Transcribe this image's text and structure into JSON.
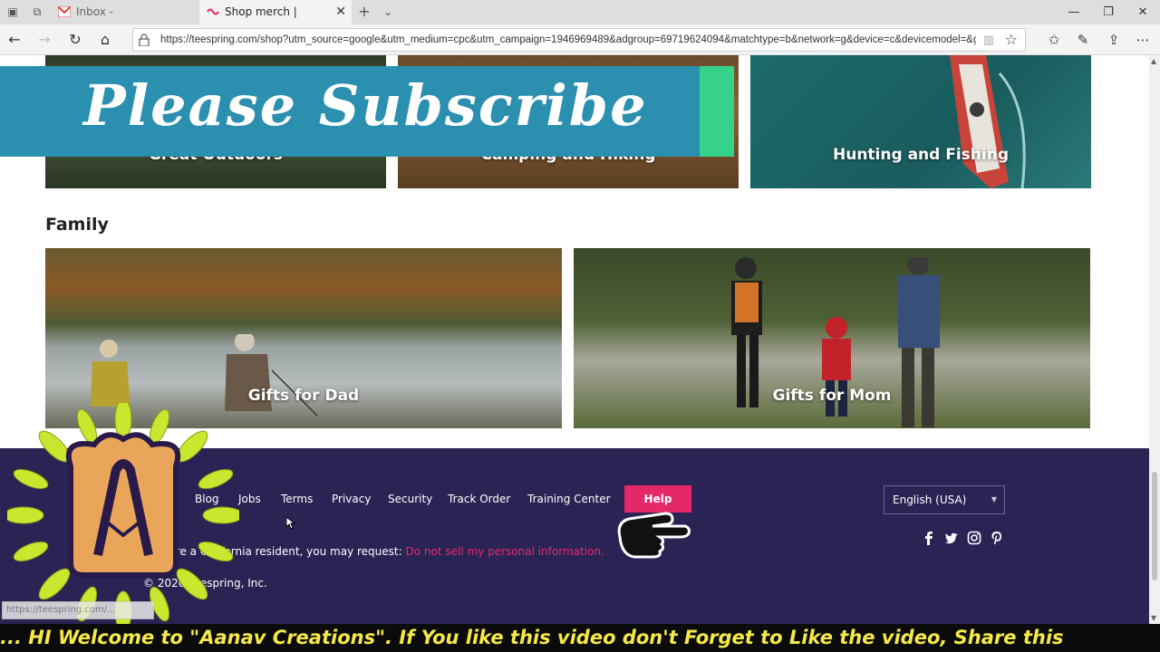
{
  "browser": {
    "tabs": [
      {
        "title": "Inbox - nigrity@gmail.com",
        "active": false
      },
      {
        "title": "Shop merch | Teespring",
        "active": true
      }
    ],
    "url": "https://teespring.com/shop?utm_source=google&utm_medium=cpc&utm_campaign=1946969489&adgroup=69719624094&matchtype=b&network=g&device=c&devicemodel=&gclid="
  },
  "outdoors": {
    "cards": [
      {
        "label": "Great Outdoors"
      },
      {
        "label": "Camping and Hiking"
      },
      {
        "label": "Hunting and Fishing"
      }
    ]
  },
  "family": {
    "title": "Family",
    "cards": [
      {
        "label": "Gifts for Dad"
      },
      {
        "label": "Gifts for Mom"
      }
    ]
  },
  "footer": {
    "links": [
      "Blog",
      "Jobs",
      "Terms",
      "Privacy",
      "Security",
      "Track Order",
      "Training Center"
    ],
    "help_label": "Help",
    "language": "English (USA)",
    "ca_prefix": "u are a California resident, you may request:",
    "ca_link": "Do not sell my personal information.",
    "copyright": "© 2020 Teespring, Inc."
  },
  "overlay": {
    "subscribe": "Please Subscribe",
    "ticker": "... HI Welcome to \"Aanav Creations\". If You like this video don't Forget to Like the video, Share this",
    "status_url": "https://teespring.com/..."
  },
  "colors": {
    "footer_bg": "#2a2455",
    "help_button": "#e5286a",
    "banner": "#2b8fb0",
    "banner_accent": "#36d28a",
    "ticker_text": "#f5e94a"
  }
}
